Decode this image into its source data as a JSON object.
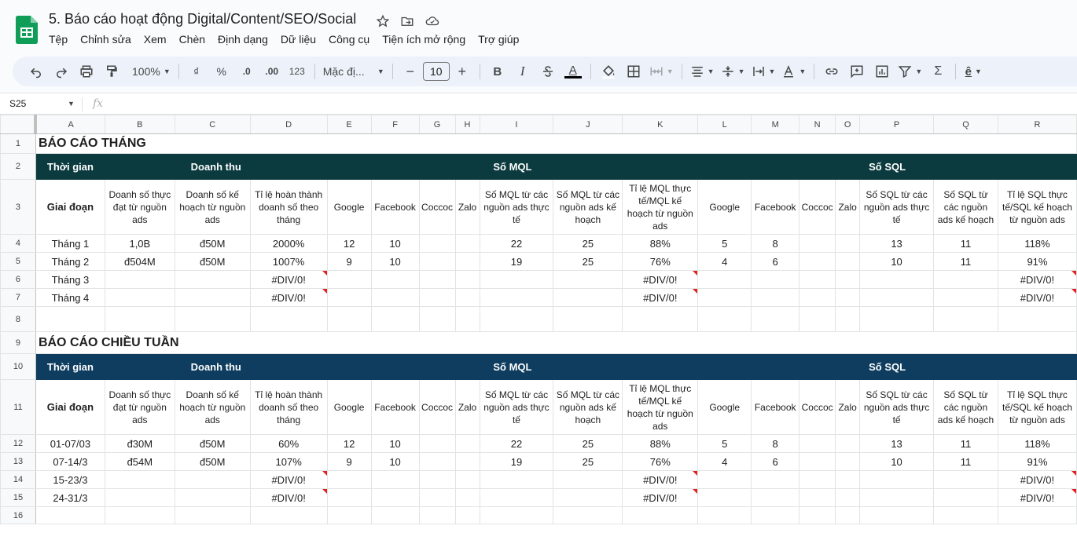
{
  "app": {
    "doc_title": "5. Báo cáo hoạt động Digital/Content/SEO/Social",
    "menu": [
      "Tệp",
      "Chỉnh sửa",
      "Xem",
      "Chèn",
      "Định dạng",
      "Dữ liệu",
      "Công cụ",
      "Tiện ích mở rộng",
      "Trợ giúp"
    ]
  },
  "toolbar": {
    "zoom": "100%",
    "currency": "₫",
    "percent": "%",
    "dec_decrease": ".0",
    "dec_increase": ".00",
    "number_format": "123",
    "font": "Mặc đị...",
    "font_size": "10",
    "minus": "−",
    "plus": "+",
    "bold": "B",
    "italic": "I",
    "text_color_letter": "A"
  },
  "formula_bar": {
    "cell_ref": "S25",
    "fx": "fx"
  },
  "columns": [
    "A",
    "B",
    "C",
    "D",
    "E",
    "F",
    "G",
    "H",
    "I",
    "J",
    "K",
    "L",
    "M",
    "N",
    "O",
    "P",
    "Q",
    "R"
  ],
  "rows": [
    "1",
    "2",
    "3",
    "4",
    "5",
    "6",
    "7",
    "8",
    "9",
    "10",
    "11",
    "12",
    "13",
    "14",
    "15",
    "16"
  ],
  "colors": {
    "header_dark_1": "#0c3b3f",
    "header_dark_2": "#0e3d5f",
    "error_marker": "#e21f1f"
  },
  "sheet": {
    "monthly": {
      "section_title": "BÁO CÁO THÁNG",
      "group_headers": {
        "time": "Thời gian",
        "revenue": "Doanh thu",
        "mql": "Số MQL",
        "sql": "Số SQL"
      },
      "sub_headers": [
        "Giai đoạn",
        "Doanh số thực đạt từ nguồn ads",
        "Doanh số kế hoạch từ nguồn ads",
        "Tỉ lệ hoàn thành doanh số theo tháng",
        "Google",
        "Facebook",
        "Coccoc",
        "Zalo",
        "Số MQL từ các nguồn ads thực tế",
        "Số MQL từ các nguồn ads kế hoạch",
        "Tỉ lệ MQL thực tế/MQL kế hoạch từ nguồn ads",
        "Google",
        "Facebook",
        "Coccoc",
        "Zalo",
        "Số SQL từ các nguồn ads thực tế",
        "Số SQL từ các nguồn ads kế hoạch",
        "Tỉ lệ SQL thực tế/SQL kế hoạch từ nguồn ads"
      ],
      "rows": [
        [
          "Tháng 1",
          "1,0B",
          "đ50M",
          "2000%",
          "12",
          "10",
          "",
          "",
          "22",
          "25",
          "88%",
          "5",
          "8",
          "",
          "",
          "13",
          "11",
          "118%"
        ],
        [
          "Tháng 2",
          "đ504M",
          "đ50M",
          "1007%",
          "9",
          "10",
          "",
          "",
          "19",
          "25",
          "76%",
          "4",
          "6",
          "",
          "",
          "10",
          "11",
          "91%"
        ],
        [
          "Tháng 3",
          "",
          "",
          "#DIV/0!",
          "",
          "",
          "",
          "",
          "",
          "",
          "#DIV/0!",
          "",
          "",
          "",
          "",
          "",
          "",
          "#DIV/0!"
        ],
        [
          "Tháng 4",
          "",
          "",
          "#DIV/0!",
          "",
          "",
          "",
          "",
          "",
          "",
          "#DIV/0!",
          "",
          "",
          "",
          "",
          "",
          "",
          "#DIV/0!"
        ]
      ]
    },
    "weekly": {
      "section_title": "BÁO CÁO CHIỀU TUẦN",
      "group_headers": {
        "time": "Thời gian",
        "revenue": "Doanh thu",
        "mql": "Số MQL",
        "sql": "Số SQL"
      },
      "sub_headers": [
        "Giai đoạn",
        "Doanh số thực đạt từ nguồn ads",
        "Doanh số kế hoạch từ nguồn ads",
        "Tỉ lệ hoàn thành doanh số theo tháng",
        "Google",
        "Facebook",
        "Coccoc",
        "Zalo",
        "Số MQL từ các nguồn ads thực tế",
        "Số MQL từ các nguồn ads kế hoạch",
        "Tỉ lệ MQL thực tế/MQL kế hoạch từ nguồn ads",
        "Google",
        "Facebook",
        "Coccoc",
        "Zalo",
        "Số SQL từ các nguồn ads thực tế",
        "Số SQL từ các nguồn ads kế hoạch",
        "Tỉ lệ SQL thực tế/SQL kế hoạch từ nguồn ads"
      ],
      "rows": [
        [
          "01-07/03",
          "đ30M",
          "đ50M",
          "60%",
          "12",
          "10",
          "",
          "",
          "22",
          "25",
          "88%",
          "5",
          "8",
          "",
          "",
          "13",
          "11",
          "118%"
        ],
        [
          "07-14/3",
          "đ54M",
          "đ50M",
          "107%",
          "9",
          "10",
          "",
          "",
          "19",
          "25",
          "76%",
          "4",
          "6",
          "",
          "",
          "10",
          "11",
          "91%"
        ],
        [
          "15-23/3",
          "",
          "",
          "#DIV/0!",
          "",
          "",
          "",
          "",
          "",
          "",
          "#DIV/0!",
          "",
          "",
          "",
          "",
          "",
          "",
          "#DIV/0!"
        ],
        [
          "24-31/3",
          "",
          "",
          "#DIV/0!",
          "",
          "",
          "",
          "",
          "",
          "",
          "#DIV/0!",
          "",
          "",
          "",
          "",
          "",
          "",
          "#DIV/0!"
        ]
      ]
    }
  }
}
